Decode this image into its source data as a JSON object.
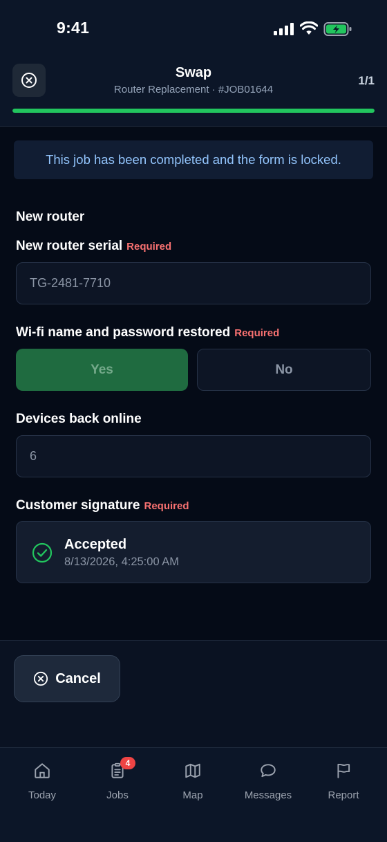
{
  "status_bar": {
    "time": "9:41"
  },
  "header": {
    "title": "Swap",
    "subtitle": "Router Replacement · #JOB01644",
    "page_count": "1/1",
    "progress_fraction": 1.0
  },
  "banner": {
    "text": "This job has been completed and the form is locked."
  },
  "form": {
    "section_title": "New router",
    "required_label": "Required",
    "serial": {
      "label": "New router serial",
      "value": "TG-2481-7710"
    },
    "wifi": {
      "label": "Wi-fi name and password restored",
      "yes_label": "Yes",
      "no_label": "No",
      "selected": "Yes"
    },
    "devices": {
      "label": "Devices back online",
      "value": "6"
    },
    "signature": {
      "label": "Customer signature",
      "status": "Accepted",
      "timestamp": "8/13/2026, 4:25:00 AM"
    }
  },
  "actions": {
    "cancel_label": "Cancel"
  },
  "tabs": [
    {
      "label": "Today",
      "icon": "home-icon"
    },
    {
      "label": "Jobs",
      "icon": "clipboard-icon",
      "badge": "4"
    },
    {
      "label": "Map",
      "icon": "map-icon"
    },
    {
      "label": "Messages",
      "icon": "chat-bubble-icon"
    },
    {
      "label": "Report",
      "icon": "flag-icon"
    }
  ],
  "colors": {
    "background": "#050b17",
    "accent_green": "#22c55e",
    "required_red": "#f87171",
    "banner_text": "#93c5fd",
    "badge_red": "#ef4444"
  }
}
